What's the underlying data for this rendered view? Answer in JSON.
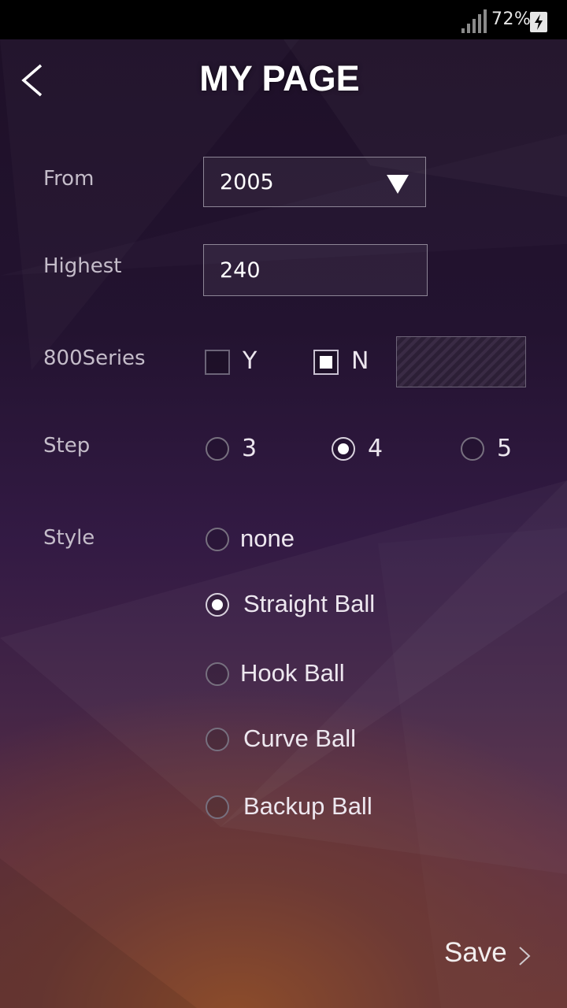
{
  "status_bar": {
    "battery_percent": "72%",
    "icons": [
      "signal-icon",
      "battery-charging-icon"
    ]
  },
  "header": {
    "title": "MY PAGE",
    "back_icon": "back-arrow-icon"
  },
  "form": {
    "from": {
      "label": "From",
      "value": "2005"
    },
    "highest": {
      "label": "Highest",
      "value": "240"
    },
    "series800": {
      "label": "800Series",
      "options": [
        {
          "label": "Y",
          "checked": false
        },
        {
          "label": "N",
          "checked": true
        }
      ]
    },
    "step": {
      "label": "Step",
      "options": [
        {
          "label": "3",
          "selected": false
        },
        {
          "label": "4",
          "selected": true
        },
        {
          "label": "5",
          "selected": false
        }
      ]
    },
    "style": {
      "label": "Style",
      "options": [
        {
          "label": "none",
          "selected": false
        },
        {
          "label": "Straight Ball",
          "selected": true
        },
        {
          "label": "Hook Ball",
          "selected": false
        },
        {
          "label": "Curve Ball",
          "selected": false
        },
        {
          "label": "Backup Ball",
          "selected": false
        }
      ]
    }
  },
  "footer": {
    "save_label": "Save",
    "icon": "chevron-right-icon"
  },
  "colors": {
    "accent_text": "#ffffff",
    "label_text": "#c4bcc9",
    "border": "#8d8596"
  }
}
